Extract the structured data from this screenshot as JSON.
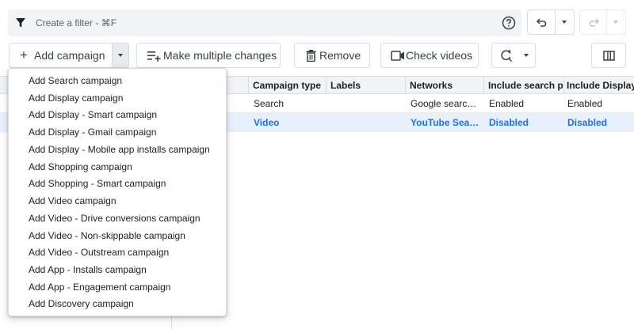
{
  "filter": {
    "placeholder": "Create a filter - ⌘F"
  },
  "toolbar": {
    "add_campaign": "Add campaign",
    "make_multiple_changes": "Make multiple changes",
    "remove": "Remove",
    "check_videos": "Check videos"
  },
  "table": {
    "columns": [
      "Campaign type",
      "Labels",
      "Networks",
      "Include search p...",
      "Include Display"
    ],
    "rows": [
      {
        "type": "Search",
        "labels": "",
        "networks": "Google search;...",
        "include_search": "Enabled",
        "include_display": "Enabled"
      },
      {
        "type": "Video",
        "labels": "",
        "networks": "YouTube Sear...",
        "include_search": "Disabled",
        "include_display": "Disabled"
      }
    ]
  },
  "menu": {
    "items": [
      "Add Search campaign",
      "Add Display campaign",
      "Add Display - Smart campaign",
      "Add Display - Gmail campaign",
      "Add Display - Mobile app installs campaign",
      "Add Shopping campaign",
      "Add Shopping - Smart campaign",
      "Add Video campaign",
      "Add Video - Drive conversions campaign",
      "Add Video - Non-skippable campaign",
      "Add Video - Outstream campaign",
      "Add App - Installs campaign",
      "Add App - Engagement campaign",
      "Add Discovery campaign"
    ]
  },
  "colors": {
    "accent": "#1a73e8",
    "selected_row": "#e8f0fe",
    "header_bg": "#f1f3f4"
  }
}
